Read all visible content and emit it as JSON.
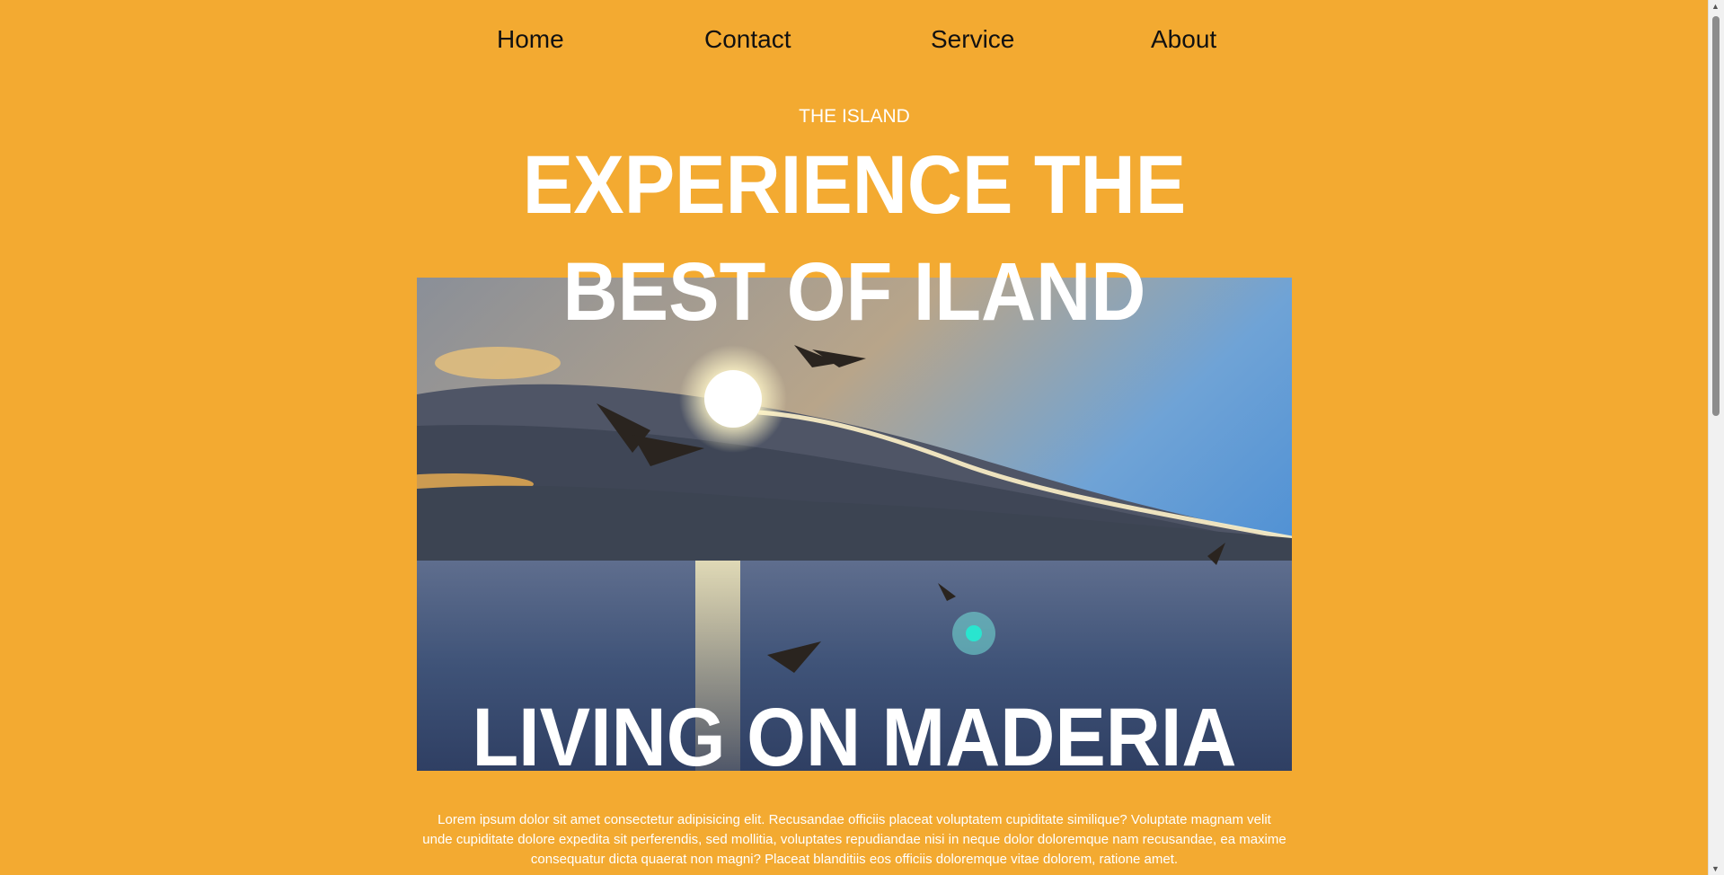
{
  "nav": {
    "items": [
      {
        "label": "Home"
      },
      {
        "label": "Contact"
      },
      {
        "label": "Service"
      },
      {
        "label": "About"
      }
    ]
  },
  "hero": {
    "eyebrow": "THE ISLAND",
    "headline_line1": "EXPERIENCE THE",
    "headline_line2": "BEST OF ILAND",
    "headline_line3": "LIVING ON MADERIA",
    "paragraph": "Lorem ipsum dolor sit amet consectetur adipisicing elit. Recusandae officiis placeat voluptatem cupiditate similique? Voluptate magnam velit unde cupiditate dolore expedita sit perferendis, sed mollitia, voluptates repudiandae nisi in neque dolor doloremque nam recusandae, ea maxime consequatur dicta quaerat non magni? Placeat blanditiis eos officiis doloremque vitae dolorem, ratione amet."
  },
  "colors": {
    "background": "#f3aa31",
    "text_light": "#ffffff",
    "nav_text": "#111111"
  },
  "icons": {
    "scroll_up": "triangle-up",
    "scroll_down": "triangle-down"
  }
}
